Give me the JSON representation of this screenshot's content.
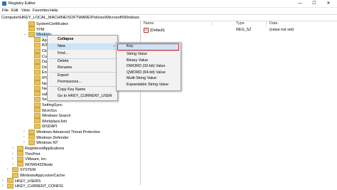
{
  "window": {
    "title": "Registry Editor",
    "minimize": "—",
    "maximize": "☐",
    "close": "✕"
  },
  "menu": [
    "File",
    "Edit",
    "View",
    "Favorites",
    "Help"
  ],
  "address": "Computer\\HKEY_LOCAL_MACHINE\\SOFTWARE\\Policies\\Microsoft\\Windows",
  "tree": [
    {
      "label": "SystemCertificates"
    },
    {
      "label": "TPM"
    },
    {
      "label": "Windows"
    },
    {
      "label": "Appx"
    },
    {
      "label": "BITS"
    },
    {
      "label": "Clou"
    },
    {
      "label": "Curre"
    },
    {
      "label": "Data"
    },
    {
      "label": "Delie"
    },
    {
      "label": "Enhe"
    },
    {
      "label": "IPSec"
    },
    {
      "label": "Netw"
    },
    {
      "label": "Netw"
    },
    {
      "label": "safer"
    },
    {
      "label": "Settin"
    },
    {
      "label": "SettingSync"
    },
    {
      "label": "WcmSvc"
    },
    {
      "label": "Windows Search"
    },
    {
      "label": "WorkplaceJoin"
    },
    {
      "label": "WSDAPI"
    },
    {
      "label": "Windows Advanced Threat Protection"
    },
    {
      "label": "Windows Defender"
    },
    {
      "label": "Windows NT"
    },
    {
      "label": "RegisteredApplications"
    },
    {
      "label": "ThinPrint"
    },
    {
      "label": "VMware, Inc."
    },
    {
      "label": "WOW6432Node"
    },
    {
      "label": "SYSTEM"
    },
    {
      "label": "WindowsAppLockerCache"
    },
    {
      "label": "HKEY_USERS"
    },
    {
      "label": "HKEY_CURRENT_CONFIG"
    }
  ],
  "columns": [
    "Name",
    "Type",
    "Data"
  ],
  "values": [
    {
      "name": "(Default)",
      "type": "REG_SZ",
      "data": "(value not set)"
    }
  ],
  "context_menu": [
    "Collapse",
    "New",
    "Find...",
    "Delete",
    "Rename",
    "Export",
    "Permissions...",
    "Copy Key Name",
    "Go to HKEY_CURRENT_USER"
  ],
  "submenu": [
    "Key",
    "String Value",
    "Binary Value",
    "DWORD (32-bit) Value",
    "QWORD (64-bit) Value",
    "Multi-String Value",
    "Expandable String Value"
  ],
  "colors": {
    "selection": "#cce8ff",
    "menu_highlight": "#cce4f7",
    "key_outline": "#d9232e",
    "folder": "#e8c25a"
  }
}
